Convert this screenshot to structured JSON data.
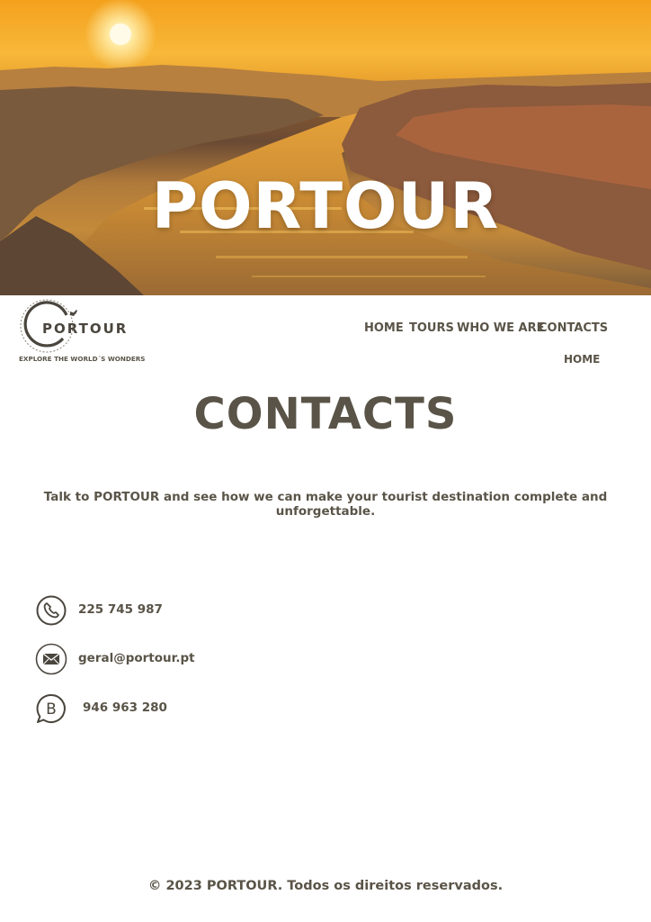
{
  "hero": {
    "title": "PORTOUR"
  },
  "brand": {
    "logo_text": "PORTOUR",
    "tagline": "EXPLORE THE WORLD´S WONDERS"
  },
  "nav": {
    "items": [
      {
        "label": "HOME"
      },
      {
        "label": "TOURS"
      },
      {
        "label": "WHO WE ARE"
      },
      {
        "label": "CONTACTS"
      },
      {
        "label": "HOME"
      }
    ]
  },
  "main": {
    "title": "CONTACTS",
    "intro": "Talk to PORTOUR and see how we can make your tourist destination complete and unforgettable."
  },
  "contacts": [
    {
      "icon": "phone-icon",
      "value": "225 745 987"
    },
    {
      "icon": "envelope-icon",
      "value": "geral@portour.pt"
    },
    {
      "icon": "whatsapp-business-icon",
      "value": "946 963 280"
    }
  ],
  "footer": {
    "copyright": "© 2023 PORTOUR. Todos os direitos reservados."
  },
  "colors": {
    "text": "#5a5448",
    "hero_sky": "#f2a21c",
    "background": "#ffffff"
  }
}
